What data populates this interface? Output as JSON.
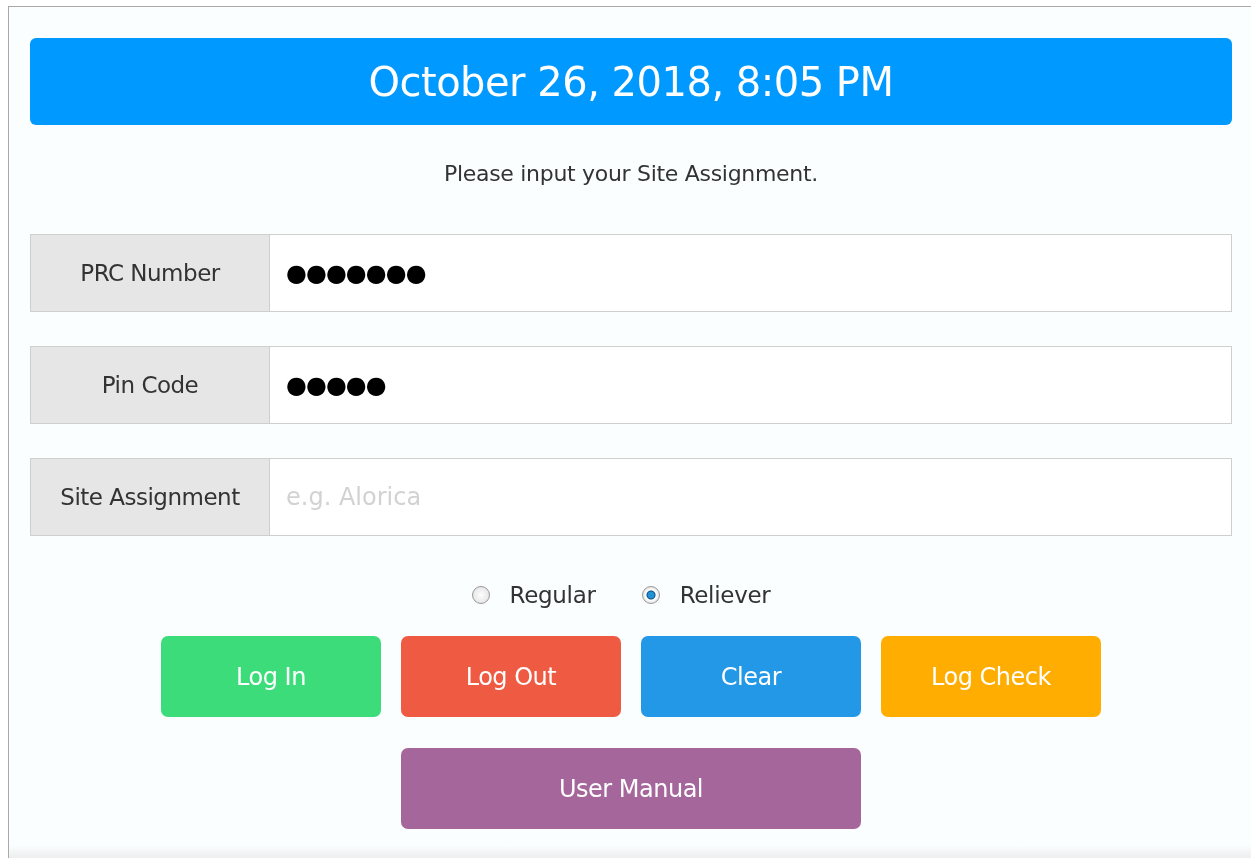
{
  "header": {
    "datetime": "October 26, 2018, 8:05 PM"
  },
  "instruction": "Please input your Site Assignment.",
  "fields": [
    {
      "label": "PRC Number",
      "value": "●●●●●●●"
    },
    {
      "label": "Pin Code",
      "value": "●●●●●"
    },
    {
      "label": "Site Assignment",
      "placeholder": "e.g. Alorica"
    }
  ],
  "employment_type": [
    {
      "label": "Regular",
      "selected": false
    },
    {
      "label": "Reliever",
      "selected": true
    }
  ],
  "buttons": [
    {
      "label": "Log In",
      "color": "#3ddc7a",
      "kind": "normal"
    },
    {
      "label": "Log Out",
      "color": "#ee5a42",
      "kind": "normal"
    },
    {
      "label": "Clear",
      "color": "#2298e6",
      "kind": "normal"
    },
    {
      "label": "Log Check",
      "color": "#ffad00",
      "kind": "normal"
    },
    {
      "label": "User Manual",
      "color": "#a5669b",
      "kind": "wide"
    }
  ]
}
